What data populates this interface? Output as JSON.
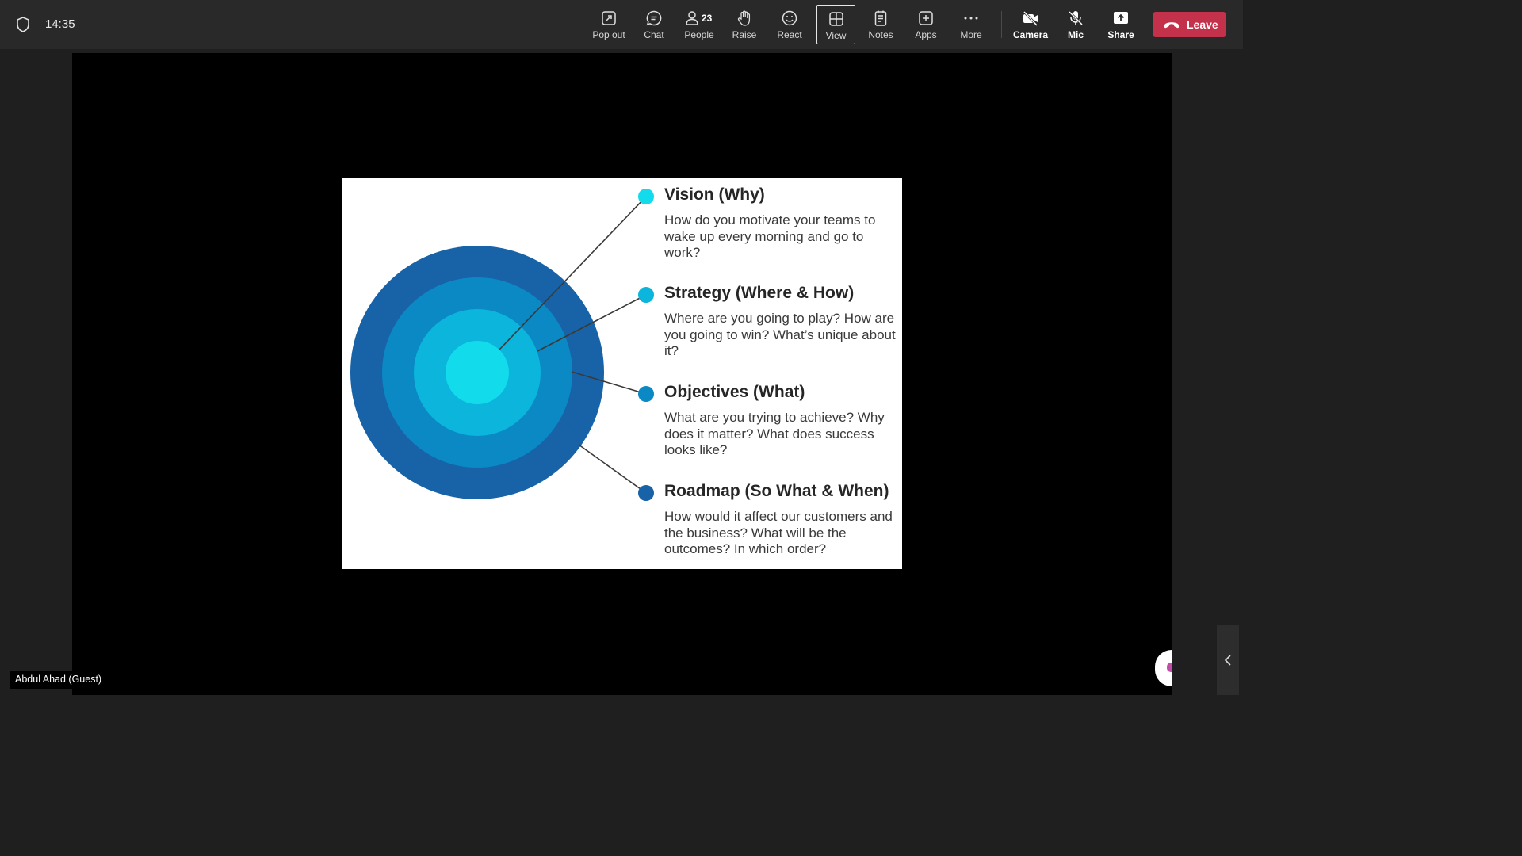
{
  "header": {
    "time": "14:35",
    "toolbar": {
      "pop_out": "Pop out",
      "chat": "Chat",
      "people": "People",
      "people_count": "23",
      "raise": "Raise",
      "react": "React",
      "view": "View",
      "notes": "Notes",
      "apps": "Apps",
      "more": "More",
      "camera": "Camera",
      "mic": "Mic",
      "share": "Share",
      "leave": "Leave"
    },
    "leave_color": "#c4314b"
  },
  "slide": {
    "items": [
      {
        "title": "Vision (Why)",
        "desc": "How do you motivate your teams to wake up every morning and go to work?",
        "color": "#12dceb"
      },
      {
        "title": "Strategy (Where & How)",
        "desc": "Where are you going to play? How are you going to win? What’s unique about it?",
        "color": "#0bb5dc"
      },
      {
        "title": "Objectives (What)",
        "desc": "What are you trying to achieve? Why does it matter? What does success looks like?",
        "color": "#0a89c4"
      },
      {
        "title": "Roadmap (So What & When)",
        "desc": "How would it affect our customers and the business? What will be the outcomes? In which order?",
        "color": "#1862a8"
      }
    ]
  },
  "participant": {
    "name": "Abdul Ahad (Guest)"
  }
}
